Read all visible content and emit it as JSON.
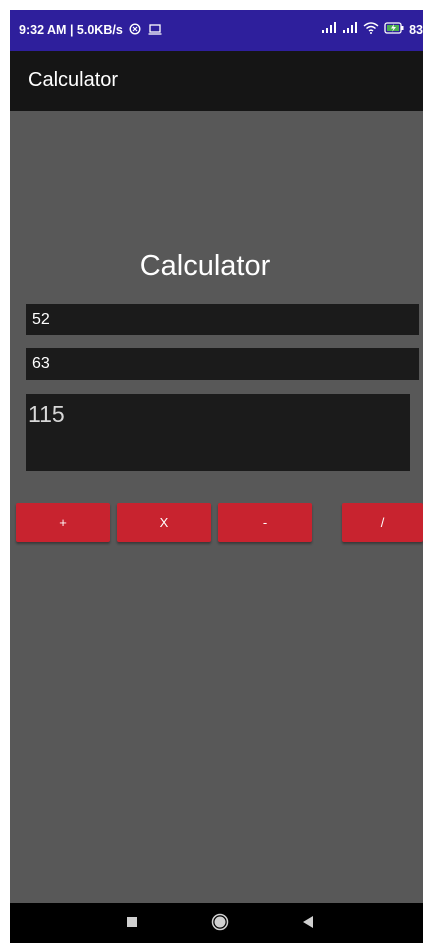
{
  "status_bar": {
    "left_text": "9:32 AM | 5.0KB/s",
    "battery": "83",
    "icons": [
      "vpn-icon",
      "screen-icon",
      "signal-icon",
      "signal-icon",
      "wifi-icon",
      "battery-charging-icon"
    ]
  },
  "app_bar": {
    "title": "Calculator"
  },
  "main": {
    "heading": "Calculator",
    "first_number": "52",
    "second_number": "63",
    "result": "115",
    "buttons": {
      "add": "+",
      "multiply": "X",
      "subtract": "-",
      "divide": "/"
    }
  },
  "nav_bar": {
    "icons": [
      "recents-icon",
      "home-icon",
      "back-icon"
    ]
  },
  "colors": {
    "status_bar": "#2e1f9c",
    "app_bar": "#151515",
    "background": "#585858",
    "field": "#1b1b1b",
    "button": "#c8232f"
  }
}
